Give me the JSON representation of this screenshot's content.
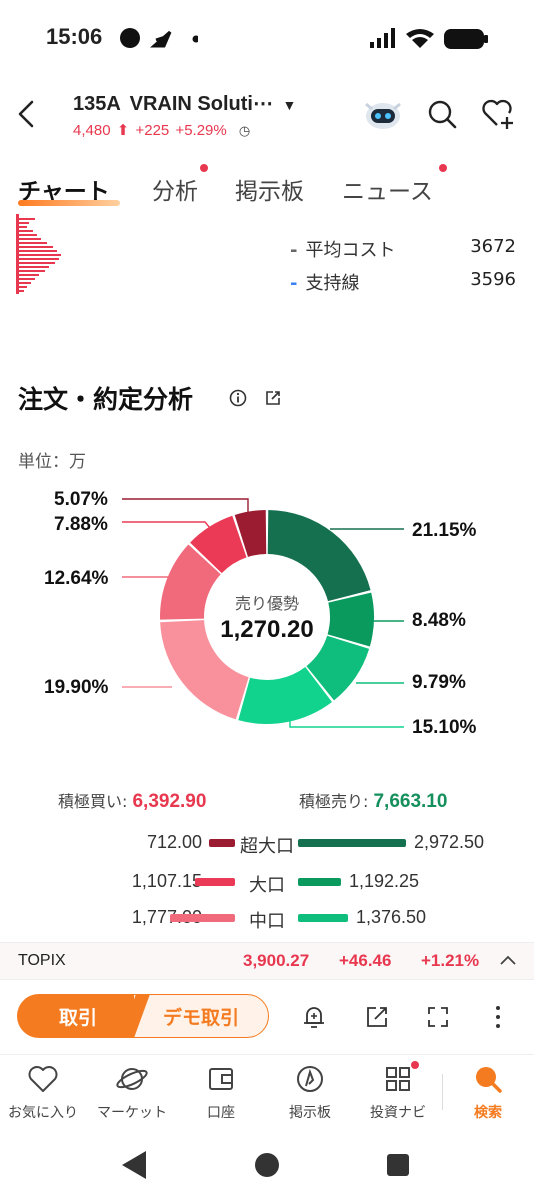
{
  "status_bar": {
    "time": "15:06"
  },
  "header": {
    "ticker_code": "135A",
    "ticker_name": "VRAIN Soluti⋯",
    "price": "4,480",
    "change": "+225",
    "change_pct": "+5.29%"
  },
  "tabs": [
    {
      "label": "チャート",
      "active": true
    },
    {
      "label": "分析",
      "dot": true
    },
    {
      "label": "掲示板"
    },
    {
      "label": "ニュース",
      "dot": true
    }
  ],
  "price_legend": [
    {
      "label": "平均コスト",
      "value": "3672",
      "color": "#888888"
    },
    {
      "label": "支持線",
      "value": "3596",
      "color": "#3b82f6"
    }
  ],
  "section": {
    "title": "注文・約定分析",
    "unit": "単位：万"
  },
  "donut": {
    "center_label": "売り優勢",
    "center_value": "1,270.20",
    "segments": [
      {
        "name": "sell-large",
        "pct": "21.15%",
        "value": 21.15,
        "color": "#15704f"
      },
      {
        "name": "sell-medium",
        "pct": "8.48%",
        "value": 8.48,
        "color": "#0a9a5e"
      },
      {
        "name": "sell-small",
        "pct": "9.79%",
        "value": 9.79,
        "color": "#0fbd7c"
      },
      {
        "name": "sell-tiny",
        "pct": "15.10%",
        "value": 15.1,
        "color": "#11d38d"
      },
      {
        "name": "buy-tiny",
        "pct": "19.90%",
        "value": 19.9,
        "color": "#f8919c"
      },
      {
        "name": "buy-small",
        "pct": "12.64%",
        "value": 12.64,
        "color": "#f06a7c"
      },
      {
        "name": "buy-medium",
        "pct": "7.88%",
        "value": 7.88,
        "color": "#ea3a55"
      },
      {
        "name": "buy-large",
        "pct": "5.07%",
        "value": 5.07,
        "color": "#9b1c30"
      }
    ]
  },
  "totals": {
    "buy_label": "積極買い: ",
    "buy_value": "6,392.90",
    "sell_label": "積極売り: ",
    "sell_value": "7,663.10"
  },
  "volume_rows": [
    {
      "label": "超大口",
      "buy": "712.00",
      "sell": "2,972.50",
      "buy_frac": 0.24,
      "sell_frac": 1.0,
      "buy_color": "#9b1c30",
      "sell_color": "#15704f"
    },
    {
      "label": "大口",
      "buy": "1,107.15",
      "sell": "1,192.25",
      "buy_frac": 0.37,
      "sell_frac": 0.4,
      "buy_color": "#ea3a55",
      "sell_color": "#0a9a5e"
    },
    {
      "label": "中口",
      "buy": "1,777.00",
      "sell": "1,376.50",
      "buy_frac": 0.6,
      "sell_frac": 0.46,
      "buy_color": "#f06a7c",
      "sell_color": "#0fbd7c"
    }
  ],
  "index_strip": {
    "name": "TOPIX",
    "value": "3,900.27",
    "change": "+46.46",
    "change_pct": "+1.21%"
  },
  "actions": {
    "trade": "取引",
    "demo_trade": "デモ取引"
  },
  "bottom_nav": [
    {
      "label": "お気に入り",
      "icon": "heart-icon"
    },
    {
      "label": "マーケット",
      "icon": "planet-icon"
    },
    {
      "label": "口座",
      "icon": "wallet-icon"
    },
    {
      "label": "掲示板",
      "icon": "board-icon"
    },
    {
      "label": "投資ナビ",
      "icon": "grid-icon"
    },
    {
      "label": "検索",
      "icon": "search-icon",
      "active": true
    }
  ]
}
